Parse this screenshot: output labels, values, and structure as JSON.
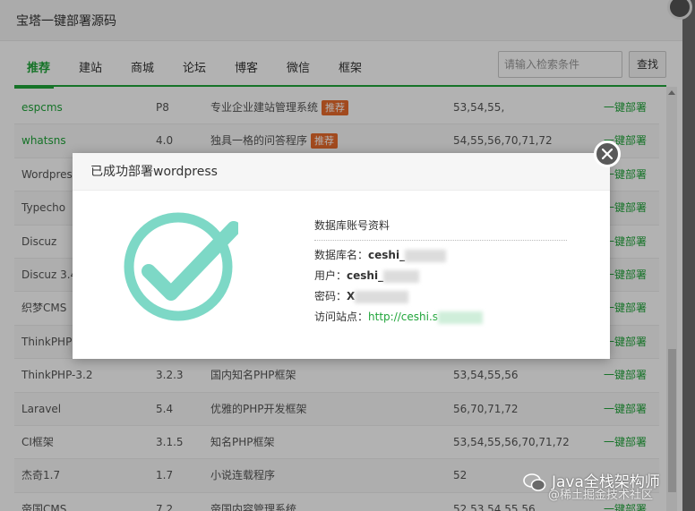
{
  "main": {
    "title": "宝塔一键部署源码",
    "tabs": [
      "推荐",
      "建站",
      "商城",
      "论坛",
      "博客",
      "微信",
      "框架"
    ],
    "search_placeholder": "请输入检索条件",
    "search_button": "查找"
  },
  "table": {
    "rows": [
      {
        "name": "espcms",
        "ver": "P8",
        "desc": "专业企业建站管理系统",
        "tag": "推荐",
        "php": "53,54,55,",
        "action": "一键部署"
      },
      {
        "name": "whatsns",
        "ver": "4.0",
        "desc": "独具一格的问答程序",
        "tag": "推荐",
        "php": "54,55,56,70,71,72",
        "action": "一键部署"
      },
      {
        "name": "Wordpress",
        "ver": "",
        "desc": "",
        "tag": "",
        "php": "",
        "action": "一键部署"
      },
      {
        "name": "Typecho",
        "ver": "",
        "desc": "",
        "tag": "",
        "php": "",
        "action": "一键部署"
      },
      {
        "name": "Discuz",
        "ver": "",
        "desc": "",
        "tag": "",
        "php": "",
        "action": "一键部署"
      },
      {
        "name": "Discuz 3.4",
        "ver": "",
        "desc": "",
        "tag": "",
        "php": "",
        "action": "一键部署"
      },
      {
        "name": "织梦CMS",
        "ver": "",
        "desc": "",
        "tag": "",
        "php": "",
        "action": "一键部署"
      },
      {
        "name": "ThinkPHP",
        "ver": "",
        "desc": "",
        "tag": "",
        "php": "",
        "action": "一键部署"
      },
      {
        "name": "ThinkPHP-3.2",
        "ver": "3.2.3",
        "desc": "国内知名PHP框架",
        "tag": "",
        "php": "53,54,55,56",
        "action": "一键部署"
      },
      {
        "name": "Laravel",
        "ver": "5.4",
        "desc": "优雅的PHP开发框架",
        "tag": "",
        "php": "56,70,71,72",
        "action": "一键部署"
      },
      {
        "name": "CI框架",
        "ver": "3.1.5",
        "desc": "知名PHP框架",
        "tag": "",
        "php": "53,54,55,56,70,71,72",
        "action": "一键部署"
      },
      {
        "name": "杰奇1.7",
        "ver": "1.7",
        "desc": "小说连载程序",
        "tag": "",
        "php": "52",
        "action": ""
      },
      {
        "name": "帝国CMS",
        "ver": "7.2",
        "desc": "帝国内容管理系统",
        "tag": "",
        "php": "52,53,54,55,56",
        "action": "一键部署"
      }
    ]
  },
  "popup": {
    "title": "已成功部署wordpress",
    "info_title": "数据库账号资料",
    "db_name_label": "数据库名：",
    "db_name_value": "ceshi_",
    "user_label": "用户：",
    "user_value": "ceshi_",
    "pwd_label": "密码：",
    "pwd_value": "X",
    "site_label": "访问站点：",
    "site_value": "http://ceshi.s"
  },
  "watermark": {
    "line1": "Java全栈架构师",
    "line2": "@稀土掘金技术社区"
  },
  "colors": {
    "accent": "#20a53a",
    "tag": "#e86a2c",
    "check": "#7dd8c6"
  }
}
